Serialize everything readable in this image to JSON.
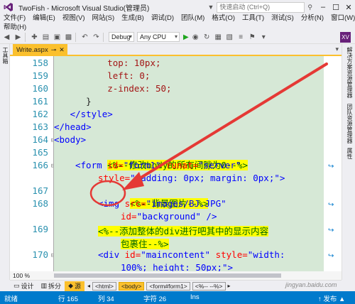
{
  "window": {
    "title": "TwoFish - Microsoft Visual Studio(管理员)",
    "quick_launch_placeholder": "快速启动 (Ctrl+Q)",
    "buttons": {
      "minimize": "–",
      "maximize": "☐",
      "close": "✕"
    }
  },
  "menu": {
    "items": [
      "文件(F)",
      "编辑(E)",
      "视图(V)",
      "网站(S)",
      "生成(B)",
      "调试(D)",
      "团队(M)",
      "格式(O)",
      "工具(T)",
      "测试(S)",
      "分析(N)",
      "窗口(W)"
    ],
    "help": "帮助(H)"
  },
  "toolbar": {
    "config": "Debug",
    "platform": "Any CPU",
    "user_badge": "XV"
  },
  "left_strip": {
    "label": "工具箱"
  },
  "right_strip": {
    "labels": [
      "解决方案资源管理器",
      "团队资源管理器",
      "属性"
    ]
  },
  "doc_tab": {
    "name": "Write.aspx",
    "pin": "⊸",
    "close": "✕"
  },
  "editor": {
    "lines": [
      {
        "num": "158",
        "fold": ""
      },
      {
        "num": "159",
        "fold": ""
      },
      {
        "num": "160",
        "fold": ""
      },
      {
        "num": "161",
        "fold": ""
      },
      {
        "num": "162",
        "fold": ""
      },
      {
        "num": "163",
        "fold": ""
      },
      {
        "num": "164",
        "fold": "⊟"
      },
      {
        "num": "165",
        "fold": ""
      },
      {
        "num": "166",
        "fold": "⊟"
      },
      {
        "num": "",
        "fold": ""
      },
      {
        "num": "167",
        "fold": ""
      },
      {
        "num": "168",
        "fold": ""
      },
      {
        "num": "",
        "fold": ""
      },
      {
        "num": "169",
        "fold": ""
      },
      {
        "num": "",
        "fold": ""
      },
      {
        "num": "170",
        "fold": "⊟"
      },
      {
        "num": "",
        "fold": ""
      }
    ],
    "code": {
      "l158": "          top: 10px;",
      "l159": "          left: 0;",
      "l160": "          z-index: 50;",
      "l161": "      }",
      "l162": "   </style>",
      "l163": "</head>",
      "l164": "<body>",
      "l165_comment": "<%--修改body的所有间隙为0--%>",
      "l166_tag": "<form",
      "l166_attr1": "id=",
      "l166_val1": "\"form1\"",
      "l166_attr2": "runat=",
      "l166_val2": "\"server\"",
      "l166b_attr": "style=",
      "l166b_val": "\"padding: 0px; margin: 0px;\"",
      "l166b_end": ">",
      "l167_comment": "<%--背景图片--%>",
      "l168_tag": "<img",
      "l168_attr": "src=",
      "l168_val": "\"images/BJ.JPG\"",
      "l168b_attr": "id=",
      "l168b_val": "\"background\"",
      "l168b_end": "/>",
      "l169_comment": "<%--添加整体的div进行吧其中的显示内容",
      "l169b_comment": "包裹住--%>",
      "l170_tag": "<div",
      "l170_attr1": "id=",
      "l170_val1": "\"maincontent\"",
      "l170_attr2": "style=",
      "l170_val2": "\"width:",
      "l170b": "100%; height: 50px;\">"
    }
  },
  "zoom": "100 %",
  "view_tabs": {
    "design": "设计",
    "split": "拆分",
    "source": "源"
  },
  "breadcrumbs": [
    "<html>",
    "<body>",
    "<form#form1>",
    "<%-- --%>"
  ],
  "status": {
    "ready": "就绪",
    "line": "行 165",
    "col": "列 34",
    "char": "字符 26",
    "ins": "Ins",
    "publish": "↑ 发布 ▲"
  },
  "watermark": "jingyan.baidu.com",
  "colors": {
    "accent": "#007acc",
    "tab": "#fbc02d",
    "highlight": "#ffff00",
    "annotation": "#e53935"
  }
}
